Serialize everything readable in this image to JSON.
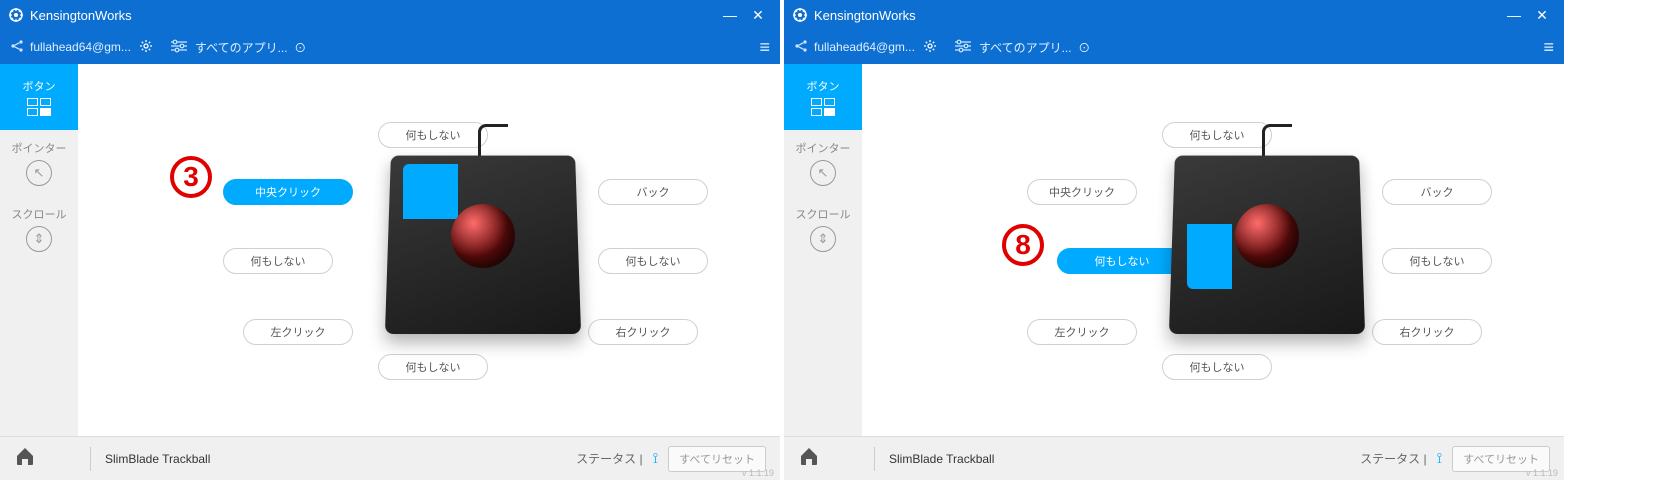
{
  "app": {
    "title": "KensingtonWorks"
  },
  "toolbar": {
    "email": "fullahead64@gm...",
    "app_selector": "すべてのアプリ..."
  },
  "sidebar": {
    "tabs": [
      {
        "label": "ボタン"
      },
      {
        "label": "ポインター"
      },
      {
        "label": "スクロール"
      }
    ]
  },
  "left": {
    "annotation": "3",
    "buttons": {
      "top_center": "何もしない",
      "mid_left_active": "中央クリック",
      "mid_right": "バック",
      "lower_left": "何もしない",
      "lower_right": "何もしない",
      "bottom_left": "左クリック",
      "bottom_right": "右クリック",
      "very_bottom": "何もしない"
    }
  },
  "right": {
    "annotation": "8",
    "buttons": {
      "top_center": "何もしない",
      "mid_left": "中央クリック",
      "mid_right": "バック",
      "lower_left_active": "何もしない",
      "lower_right": "何もしない",
      "bottom_left": "左クリック",
      "bottom_right": "右クリック",
      "very_bottom": "何もしない"
    }
  },
  "statusbar": {
    "device": "SlimBlade Trackball",
    "status_label": "ステータス",
    "reset": "すべてリセット"
  },
  "version": "v 1.1.19"
}
